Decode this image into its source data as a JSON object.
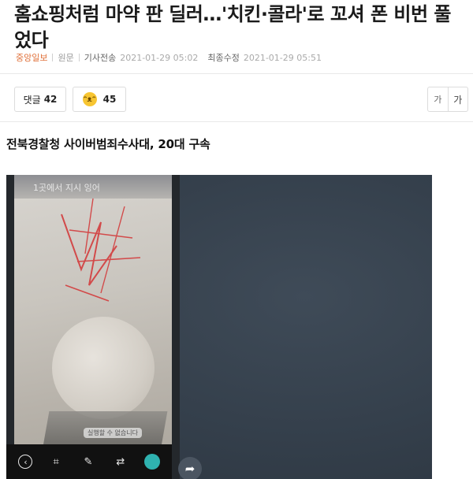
{
  "article": {
    "headline": "홈쇼핑처럼 마약 판 딜러…'치킨·콜라'로 꼬셔 폰 비번 풀었다",
    "source": "중앙일보",
    "source_type": "원문",
    "published_label": "기사전송",
    "published_time": "2021-01-29 05:02",
    "modified_label": "최종수정",
    "modified_time": "2021-01-29 05:51",
    "subheadline": "전북경찰청 사이버범죄수사대, 20대 구속"
  },
  "actions": {
    "comment_label": "댓글",
    "comment_count": "42",
    "emotion_icon": "smile-emoji-icon",
    "emotion_count": "45",
    "font_small": "가",
    "font_large": "가"
  },
  "photo": {
    "phone_header": "1곳에서 지시 잉어",
    "caption": "실행할 수 없습니다",
    "toolbar_icons": [
      "back-icon",
      "crop-icon",
      "pen-icon",
      "swap-icon",
      "sticker-icon"
    ],
    "share_icon": "share-arrow-icon",
    "colors": {
      "background": "#343f4b",
      "toolbar": "#111111",
      "accent": "#2fb2b0"
    }
  }
}
